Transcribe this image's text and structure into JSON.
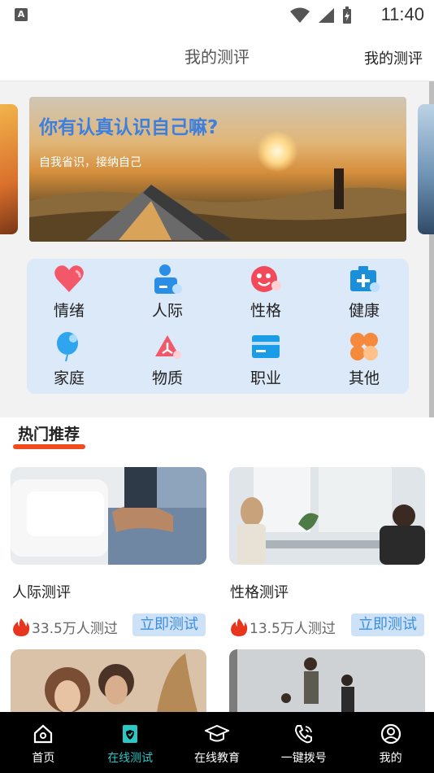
{
  "status_bar": {
    "time": "11:40",
    "badge": "A"
  },
  "header": {
    "title": "我的测评",
    "right_link": "我的测评"
  },
  "banner": {
    "headline": "你有认真认识自己嘛?",
    "subline": "自我省识，接纳自己"
  },
  "categories": [
    {
      "label": "情绪",
      "icon": "heart-icon"
    },
    {
      "label": "人际",
      "icon": "person-icon"
    },
    {
      "label": "性格",
      "icon": "smiley-icon"
    },
    {
      "label": "健康",
      "icon": "medical-kit-icon"
    },
    {
      "label": "家庭",
      "icon": "balloon-icon"
    },
    {
      "label": "物质",
      "icon": "triangle-icon"
    },
    {
      "label": "职业",
      "icon": "card-icon"
    },
    {
      "label": "其他",
      "icon": "clover-icon"
    }
  ],
  "section": {
    "title": "热门推荐"
  },
  "cards": [
    {
      "title": "人际测评",
      "count": "33.5万人测过",
      "button": "立即测试"
    },
    {
      "title": "性格测评",
      "count": "13.5万人测过",
      "button": "立即测试"
    }
  ],
  "nav": [
    {
      "label": "首页",
      "icon": "home-icon",
      "active": false
    },
    {
      "label": "在线测试",
      "icon": "test-shield-icon",
      "active": true
    },
    {
      "label": "在线教育",
      "icon": "graduation-cap-icon",
      "active": false
    },
    {
      "label": "一键拨号",
      "icon": "phone-icon",
      "active": false
    },
    {
      "label": "我的",
      "icon": "user-circle-icon",
      "active": false
    }
  ],
  "colors": {
    "accent": "#2bc6c6",
    "underline": "#f14a1d",
    "button_text": "#3d8ee0",
    "headline": "#3d7fde"
  }
}
